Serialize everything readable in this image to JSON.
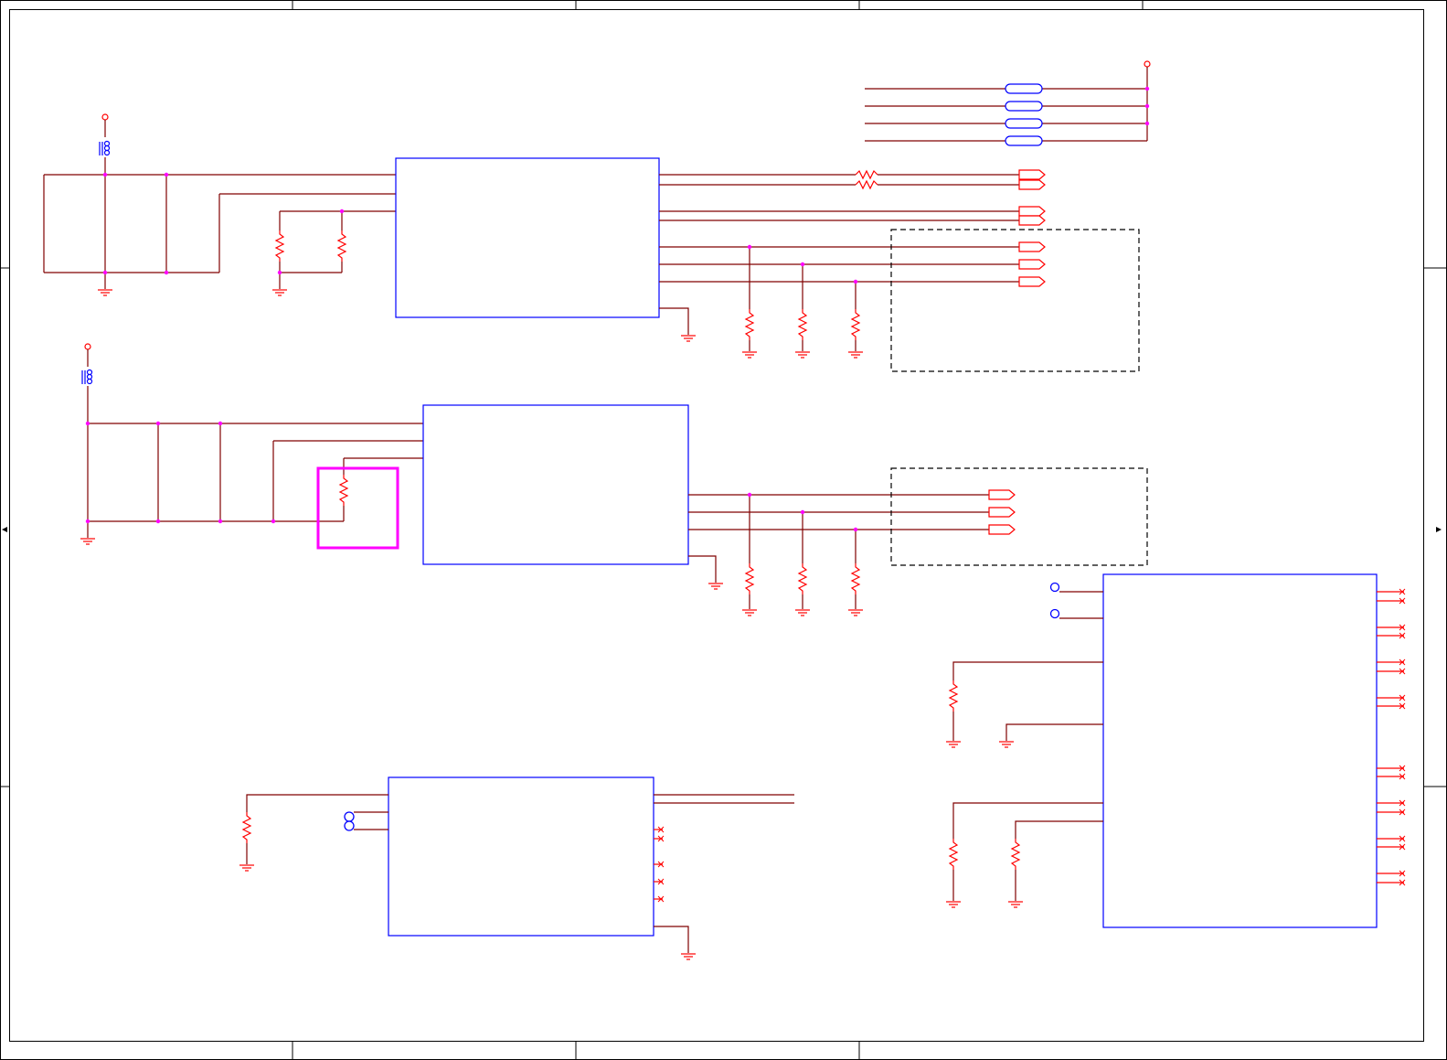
{
  "diagram": {
    "kind": "electrical schematic sheet",
    "text_labels": [],
    "colors": {
      "wire": "#800000",
      "pin": "#ff0000",
      "component_body": "#0000ff",
      "junction": "#ff00ff",
      "highlight_box": "#ff00ff",
      "frame": "#000000",
      "background": "#ffffff"
    },
    "symbols": {
      "ic_blocks": 4,
      "capacitors": 8,
      "resistors": 18,
      "ferrite_beads": 2,
      "ground_symbols": 19,
      "power_flags": 3,
      "output_ports": 10,
      "board_fuses": 4,
      "test_points": 4,
      "dashed_groups": 2,
      "highlight_boxes": 1
    },
    "icons": [
      "ground-icon",
      "power-flag-icon",
      "capacitor-icon",
      "resistor-icon",
      "ferrite-bead-icon",
      "port-icon",
      "test-point-icon",
      "no-connect-icon"
    ]
  }
}
